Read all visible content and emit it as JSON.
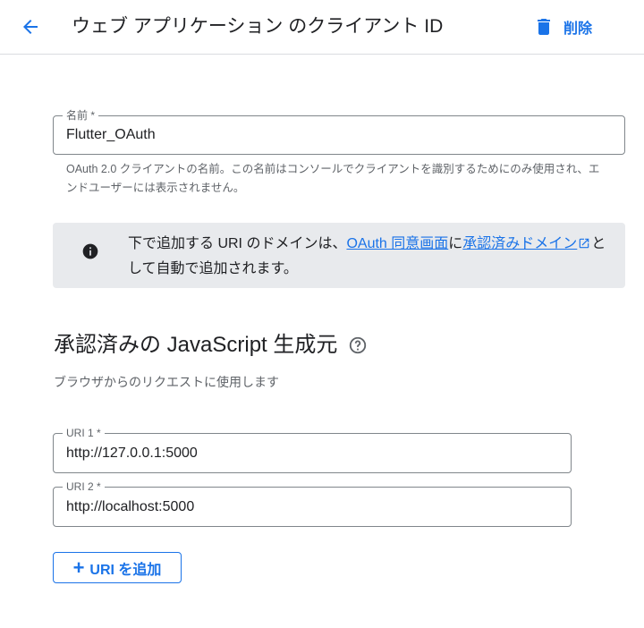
{
  "header": {
    "title": "ウェブ アプリケーション のクライアント ID",
    "delete_label": "削除"
  },
  "name_field": {
    "label": "名前 *",
    "value": "Flutter_OAuth",
    "hint": "OAuth 2.0 クライアントの名前。この名前はコンソールでクライアントを識別するためにのみ使用され、エンドユーザーには表示されません。"
  },
  "notice": {
    "text_before": "下で追加する URI のドメインは、",
    "link1": "OAuth 同意画面",
    "text_middle": "に",
    "link2": "承認済みドメイン",
    "text_after": "として自動で追加されます。"
  },
  "origins": {
    "title": "承認済みの JavaScript 生成元",
    "subtitle": "ブラウザからのリクエストに使用します",
    "uris": [
      {
        "label": "URI 1 *",
        "value": "http://127.0.0.1:5000"
      },
      {
        "label": "URI 2 *",
        "value": "http://localhost:5000"
      }
    ],
    "add_label": "URI を追加"
  },
  "colors": {
    "accent": "#1a73e8",
    "notice_bg": "#e8eaed"
  },
  "icons": {
    "back": "arrow-back-icon",
    "delete": "trash-icon",
    "info": "info-icon",
    "external": "open-in-new-icon",
    "help": "help-icon",
    "add": "plus-icon"
  }
}
